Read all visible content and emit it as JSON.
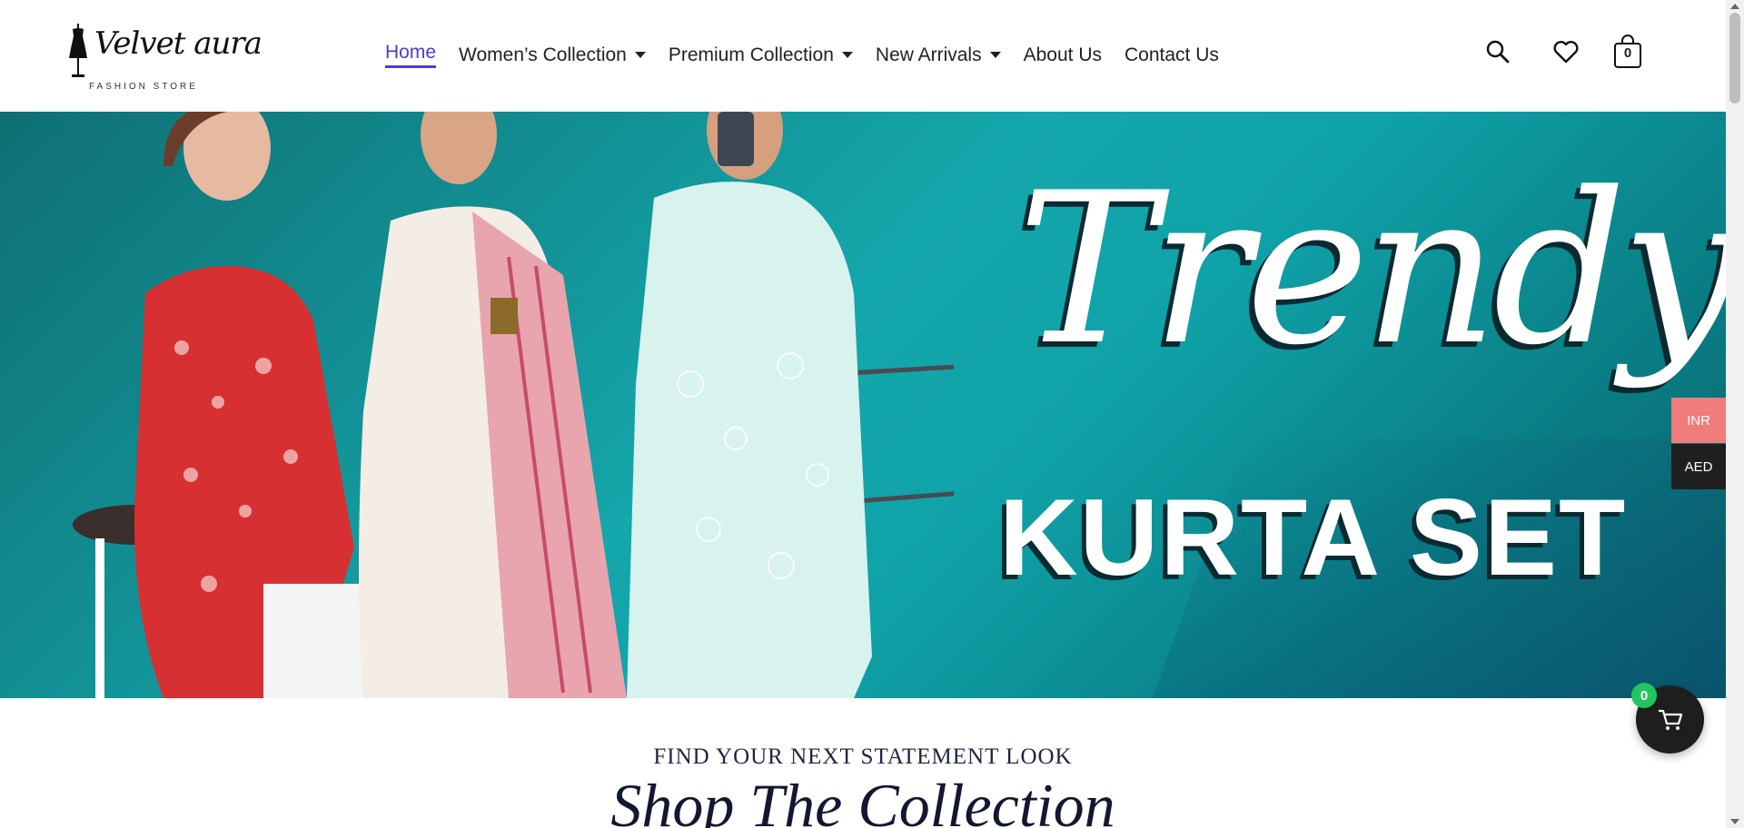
{
  "brand": {
    "logo_script": "Velvet aura",
    "logo_sub": "FASHION STORE"
  },
  "nav": {
    "items": [
      {
        "label": "Home",
        "active": true,
        "dropdown": false
      },
      {
        "label": "Women’s Collection",
        "active": false,
        "dropdown": true
      },
      {
        "label": "Premium Collection",
        "active": false,
        "dropdown": true
      },
      {
        "label": "New Arrivals",
        "active": false,
        "dropdown": true
      },
      {
        "label": "About Us",
        "active": false,
        "dropdown": false
      },
      {
        "label": "Contact Us",
        "active": false,
        "dropdown": false
      }
    ]
  },
  "header_icons": {
    "search": "search-icon",
    "wishlist": "heart-icon",
    "cart": "shopping-bag-icon",
    "cart_count": "0"
  },
  "hero": {
    "script_text": "Trendy",
    "block_text": "KURTA SET"
  },
  "currency": {
    "options": [
      "INR",
      "AED"
    ],
    "selected": "INR"
  },
  "floating_cart": {
    "count": "0"
  },
  "section": {
    "eyebrow": "FIND YOUR NEXT STATEMENT LOOK",
    "title": "Shop The Collection"
  },
  "colors": {
    "accent": "#4b3fcc",
    "hero_teal": "#14a7ab",
    "inr_bg": "#f07c7c",
    "aed_bg": "#1f1f1f",
    "badge_green": "#22c55e"
  }
}
